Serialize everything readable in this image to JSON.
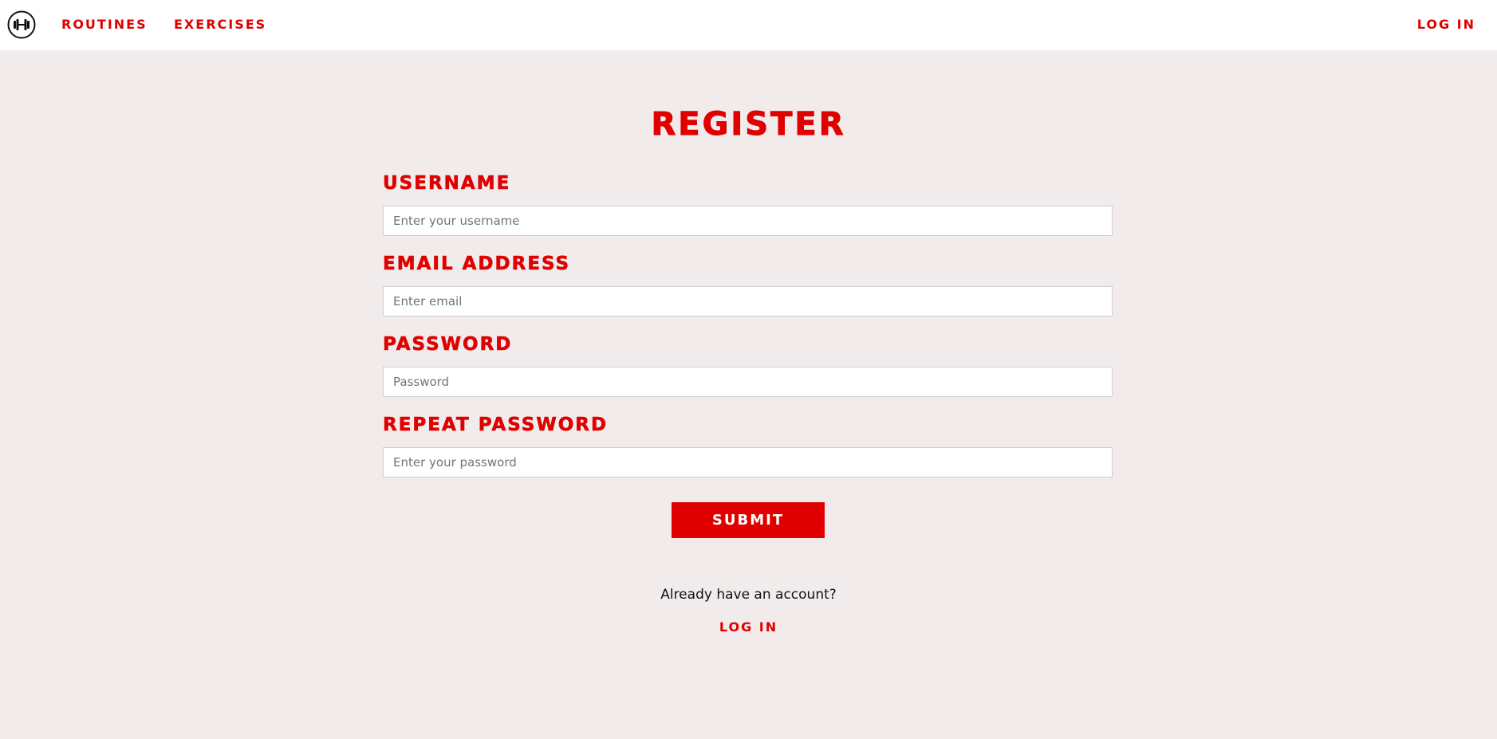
{
  "nav": {
    "logo_icon": "dumbbell-icon",
    "routines": "ROUTINES",
    "exercises": "EXERCISES",
    "login": "LOG IN"
  },
  "form": {
    "title": "REGISTER",
    "username": {
      "label": "USERNAME",
      "placeholder": "Enter your username",
      "value": ""
    },
    "email": {
      "label": "EMAIL ADDRESS",
      "placeholder": "Enter email",
      "value": ""
    },
    "password": {
      "label": "PASSWORD",
      "placeholder": "Password",
      "value": ""
    },
    "repeat_password": {
      "label": "REPEAT PASSWORD",
      "placeholder": "Enter your password",
      "value": ""
    },
    "submit": "SUBMIT",
    "already_text": "Already have an account?",
    "login_link": "LOG IN"
  },
  "colors": {
    "accent": "#e00000",
    "background": "#f1ebec",
    "navbar": "#ffffff"
  }
}
